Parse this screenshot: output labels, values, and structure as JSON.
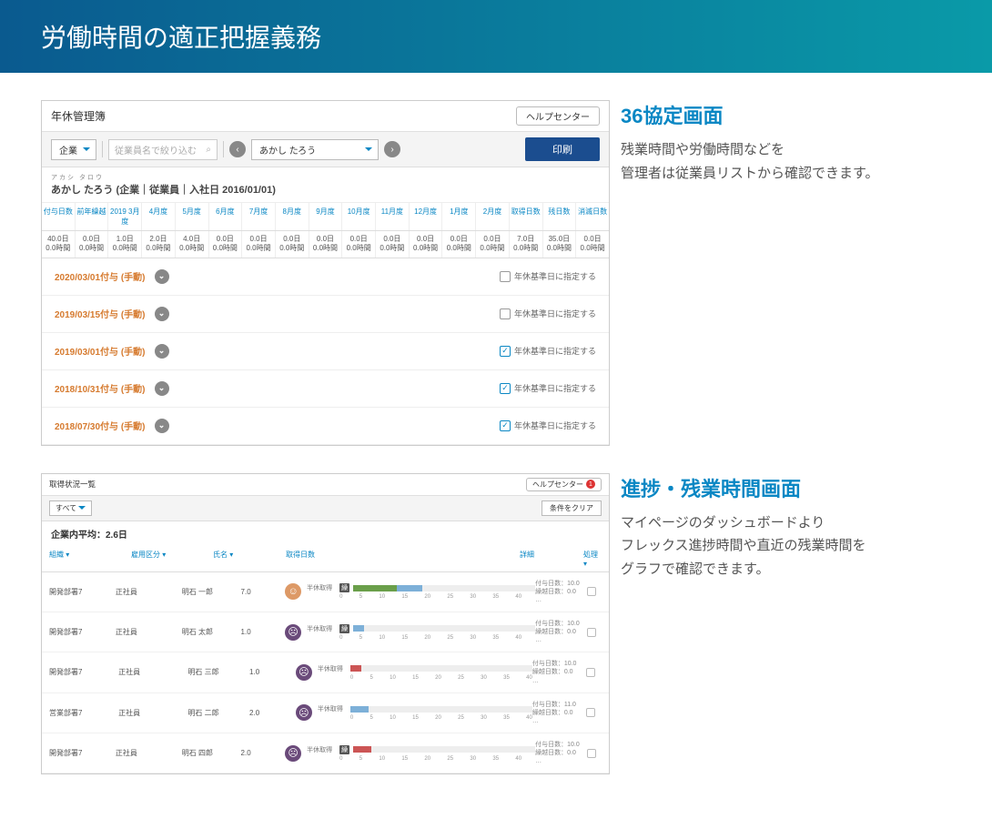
{
  "hero_title": "労働時間の適正把握義務",
  "section1": {
    "heading": "36協定画面",
    "description": "残業時間や労働時間などを\n管理者は従業員リストから確認できます。"
  },
  "section2": {
    "heading": "進捗・残業時間画面",
    "description": "マイページのダッシュボードより\nフレックス進捗時間や直近の残業時間を\nグラフで確認できます。"
  },
  "panel1": {
    "title": "年休管理簿",
    "help": "ヘルプセンター",
    "scope_label": "企業",
    "search_placeholder": "従業員名で絞り込む",
    "employee_selected": "あかし たろう",
    "print": "印刷",
    "furigana": "アカシ タロウ",
    "employee_line": "あかし たろう (企業｜従業員｜入社日 2016/01/01)",
    "month_headers": [
      "付与日数",
      "前年繰越",
      "2019 3月度",
      "4月度",
      "5月度",
      "6月度",
      "7月度",
      "8月度",
      "9月度",
      "10月度",
      "11月度",
      "12月度",
      "1月度",
      "2月度",
      "取得日数",
      "残日数",
      "消滅日数"
    ],
    "month_values": [
      "40.0日\n0.0時間",
      "0.0日\n0.0時間",
      "1.0日\n0.0時間",
      "2.0日\n0.0時間",
      "4.0日\n0.0時間",
      "0.0日\n0.0時間",
      "0.0日\n0.0時間",
      "0.0日\n0.0時間",
      "0.0日\n0.0時間",
      "0.0日\n0.0時間",
      "0.0日\n0.0時間",
      "0.0日\n0.0時間",
      "0.0日\n0.0時間",
      "0.0日\n0.0時間",
      "7.0日\n0.0時間",
      "35.0日\n0.0時間",
      "0.0日\n0.0時間"
    ],
    "checkbox_label": "年休基準日に指定する",
    "grants": [
      {
        "label": "2020/03/01付与 (手動)",
        "checked": false
      },
      {
        "label": "2019/03/15付与 (手動)",
        "checked": false
      },
      {
        "label": "2019/03/01付与 (手動)",
        "checked": true
      },
      {
        "label": "2018/10/31付与 (手動)",
        "checked": true
      },
      {
        "label": "2018/07/30付与 (手動)",
        "checked": true
      }
    ]
  },
  "panel2": {
    "title": "取得状況一覧",
    "help": "ヘルプセンター",
    "help_badge": "1",
    "filter": "すべて",
    "clear": "条件をクリア",
    "avg": "企業内平均：2.6日",
    "headers": {
      "dept": "組織 ▾",
      "type": "雇用区分 ▾",
      "name": "氏名 ▾",
      "days": "取得日数",
      "detail": "詳細",
      "action": "処理 ▾"
    },
    "series_label": "半休取得",
    "ticks": [
      "0",
      "5",
      "10",
      "15",
      "20",
      "25",
      "30",
      "35",
      "40"
    ],
    "rows": [
      {
        "dept": "開発部署7",
        "type": "正社員",
        "name": "明石 一郎",
        "days": "7.0",
        "face": "pink",
        "glyph": "☺",
        "det1": "付与日数：10.0",
        "det2": "繰越日数：0.0",
        "segs": [
          [
            "#6a9f4a",
            24
          ],
          [
            "#7db0d8",
            14
          ]
        ],
        "carry": true
      },
      {
        "dept": "開発部署7",
        "type": "正社員",
        "name": "明石 太郎",
        "days": "1.0",
        "face": "purple",
        "glyph": "☹",
        "det1": "付与日数：10.0",
        "det2": "繰越日数：0.0",
        "segs": [
          [
            "#7db0d8",
            6
          ]
        ],
        "carry": true
      },
      {
        "dept": "開発部署7",
        "type": "正社員",
        "name": "明石 三郎",
        "days": "1.0",
        "face": "purple",
        "glyph": "☹",
        "det1": "付与日数：10.0",
        "det2": "繰越日数：0.0",
        "segs": [
          [
            "#c55",
            6
          ]
        ],
        "carry": false
      },
      {
        "dept": "営業部署7",
        "type": "正社員",
        "name": "明石 二郎",
        "days": "2.0",
        "face": "purple",
        "glyph": "☹",
        "det1": "付与日数：11.0",
        "det2": "繰越日数：0.0",
        "segs": [
          [
            "#7db0d8",
            10
          ]
        ],
        "carry": false
      },
      {
        "dept": "開発部署7",
        "type": "正社員",
        "name": "明石 四郎",
        "days": "2.0",
        "face": "purple",
        "glyph": "☹",
        "det1": "付与日数：10.0",
        "det2": "繰越日数：0.0",
        "segs": [
          [
            "#c55",
            10
          ]
        ],
        "carry": true
      }
    ]
  }
}
